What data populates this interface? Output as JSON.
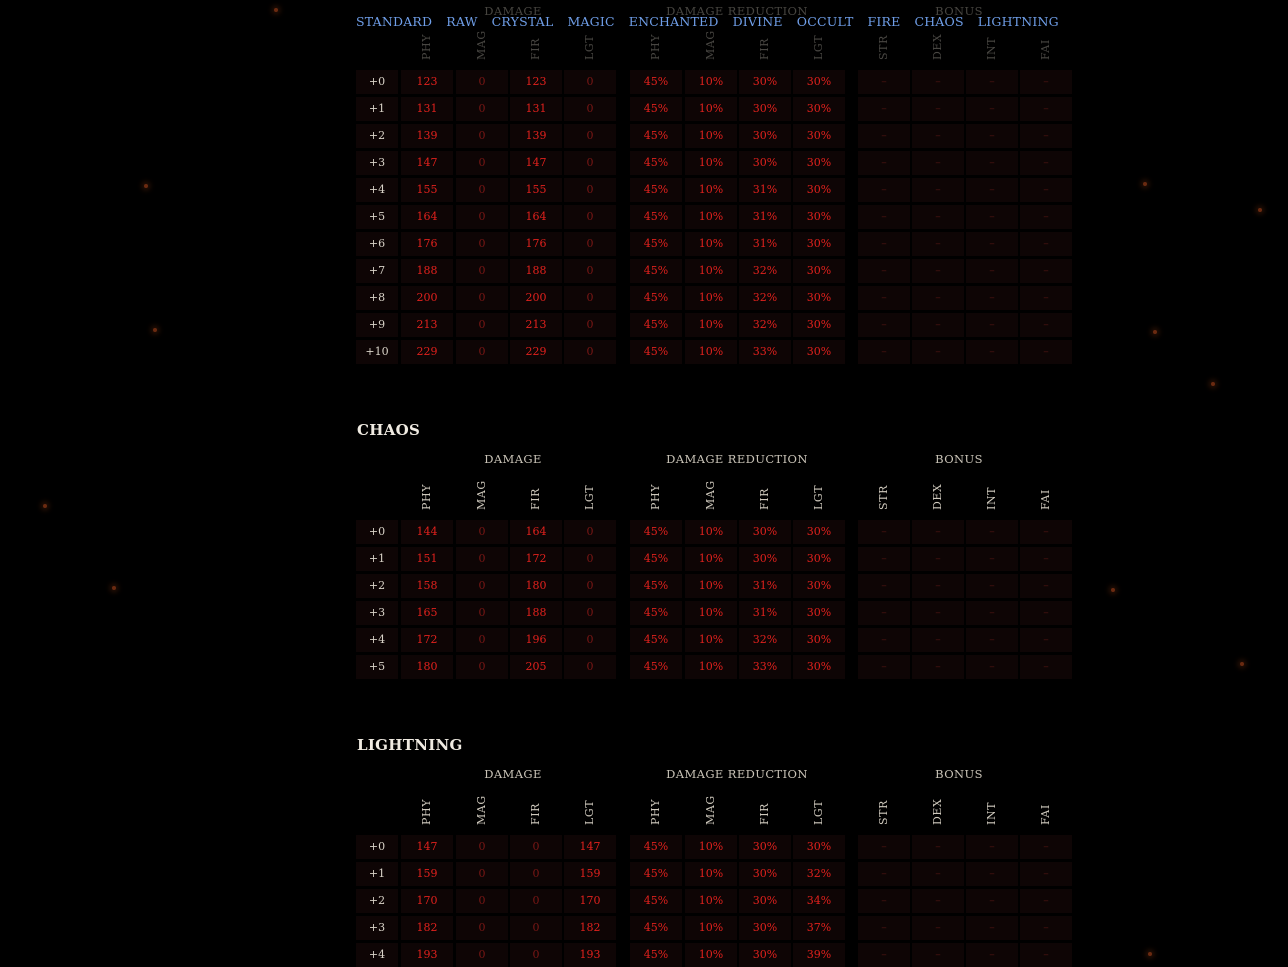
{
  "nav": [
    "STANDARD",
    "RAW",
    "CRYSTAL",
    "MAGIC",
    "ENCHANTED",
    "DIVINE",
    "OCCULT",
    "FIRE",
    "CHAOS",
    "LIGHTNING"
  ],
  "headers": {
    "groups": [
      "DAMAGE",
      "DAMAGE REDUCTION",
      "BONUS"
    ],
    "columns": [
      "PHY",
      "MAG",
      "FIR",
      "LGT",
      "PHY",
      "MAG",
      "FIR",
      "LGT",
      "STR",
      "DEX",
      "INT",
      "FAI"
    ]
  },
  "sections": [
    {
      "title": "",
      "rows": [
        [
          "+0",
          "123",
          "0",
          "123",
          "0",
          "45%",
          "10%",
          "30%",
          "30%",
          "–",
          "–",
          "–",
          "–"
        ],
        [
          "+1",
          "131",
          "0",
          "131",
          "0",
          "45%",
          "10%",
          "30%",
          "30%",
          "–",
          "–",
          "–",
          "–"
        ],
        [
          "+2",
          "139",
          "0",
          "139",
          "0",
          "45%",
          "10%",
          "30%",
          "30%",
          "–",
          "–",
          "–",
          "–"
        ],
        [
          "+3",
          "147",
          "0",
          "147",
          "0",
          "45%",
          "10%",
          "30%",
          "30%",
          "–",
          "–",
          "–",
          "–"
        ],
        [
          "+4",
          "155",
          "0",
          "155",
          "0",
          "45%",
          "10%",
          "31%",
          "30%",
          "–",
          "–",
          "–",
          "–"
        ],
        [
          "+5",
          "164",
          "0",
          "164",
          "0",
          "45%",
          "10%",
          "31%",
          "30%",
          "–",
          "–",
          "–",
          "–"
        ],
        [
          "+6",
          "176",
          "0",
          "176",
          "0",
          "45%",
          "10%",
          "31%",
          "30%",
          "–",
          "–",
          "–",
          "–"
        ],
        [
          "+7",
          "188",
          "0",
          "188",
          "0",
          "45%",
          "10%",
          "32%",
          "30%",
          "–",
          "–",
          "–",
          "–"
        ],
        [
          "+8",
          "200",
          "0",
          "200",
          "0",
          "45%",
          "10%",
          "32%",
          "30%",
          "–",
          "–",
          "–",
          "–"
        ],
        [
          "+9",
          "213",
          "0",
          "213",
          "0",
          "45%",
          "10%",
          "32%",
          "30%",
          "–",
          "–",
          "–",
          "–"
        ],
        [
          "+10",
          "229",
          "0",
          "229",
          "0",
          "45%",
          "10%",
          "33%",
          "30%",
          "–",
          "–",
          "–",
          "–"
        ]
      ]
    },
    {
      "title": "CHAOS",
      "rows": [
        [
          "+0",
          "144",
          "0",
          "164",
          "0",
          "45%",
          "10%",
          "30%",
          "30%",
          "–",
          "–",
          "–",
          "–"
        ],
        [
          "+1",
          "151",
          "0",
          "172",
          "0",
          "45%",
          "10%",
          "30%",
          "30%",
          "–",
          "–",
          "–",
          "–"
        ],
        [
          "+2",
          "158",
          "0",
          "180",
          "0",
          "45%",
          "10%",
          "31%",
          "30%",
          "–",
          "–",
          "–",
          "–"
        ],
        [
          "+3",
          "165",
          "0",
          "188",
          "0",
          "45%",
          "10%",
          "31%",
          "30%",
          "–",
          "–",
          "–",
          "–"
        ],
        [
          "+4",
          "172",
          "0",
          "196",
          "0",
          "45%",
          "10%",
          "32%",
          "30%",
          "–",
          "–",
          "–",
          "–"
        ],
        [
          "+5",
          "180",
          "0",
          "205",
          "0",
          "45%",
          "10%",
          "33%",
          "30%",
          "–",
          "–",
          "–",
          "–"
        ]
      ]
    },
    {
      "title": "LIGHTNING",
      "rows": [
        [
          "+0",
          "147",
          "0",
          "0",
          "147",
          "45%",
          "10%",
          "30%",
          "30%",
          "–",
          "–",
          "–",
          "–"
        ],
        [
          "+1",
          "159",
          "0",
          "0",
          "159",
          "45%",
          "10%",
          "30%",
          "32%",
          "–",
          "–",
          "–",
          "–"
        ],
        [
          "+2",
          "170",
          "0",
          "0",
          "170",
          "45%",
          "10%",
          "30%",
          "34%",
          "–",
          "–",
          "–",
          "–"
        ],
        [
          "+3",
          "182",
          "0",
          "0",
          "182",
          "45%",
          "10%",
          "30%",
          "37%",
          "–",
          "–",
          "–",
          "–"
        ],
        [
          "+4",
          "193",
          "0",
          "0",
          "193",
          "45%",
          "10%",
          "30%",
          "39%",
          "–",
          "–",
          "–",
          "–"
        ]
      ]
    }
  ],
  "colors": {
    "background": "#000000",
    "nav_link": "#6f9ee8",
    "value": "#e0211d",
    "zero": "#7a1715",
    "dash": "#4a1412",
    "cell_bg": "#0e0505"
  }
}
